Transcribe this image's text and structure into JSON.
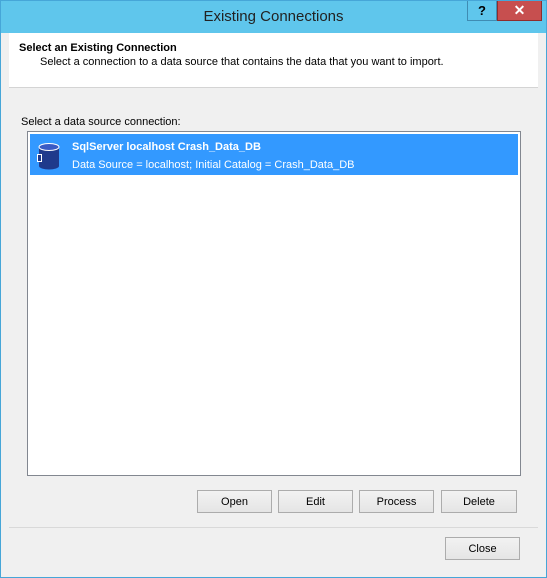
{
  "window": {
    "title": "Existing Connections",
    "help_label": "?",
    "close_label": "✕"
  },
  "header": {
    "title": "Select an Existing Connection",
    "description": "Select a connection to a data source that contains the data that you want to import."
  },
  "connections": {
    "label": "Select a data source connection:",
    "items": [
      {
        "name": "SqlServer localhost Crash_Data_DB",
        "detail": "Data Source = localhost;  Initial Catalog = Crash_Data_DB",
        "icon": "database-icon",
        "selected": true
      }
    ]
  },
  "actions": {
    "open": "Open",
    "edit": "Edit",
    "process": "Process",
    "delete": "Delete"
  },
  "footer": {
    "close": "Close"
  },
  "colors": {
    "titlebar": "#5fc6ec",
    "selection": "#3399ff",
    "close_button": "#c74f4f"
  }
}
